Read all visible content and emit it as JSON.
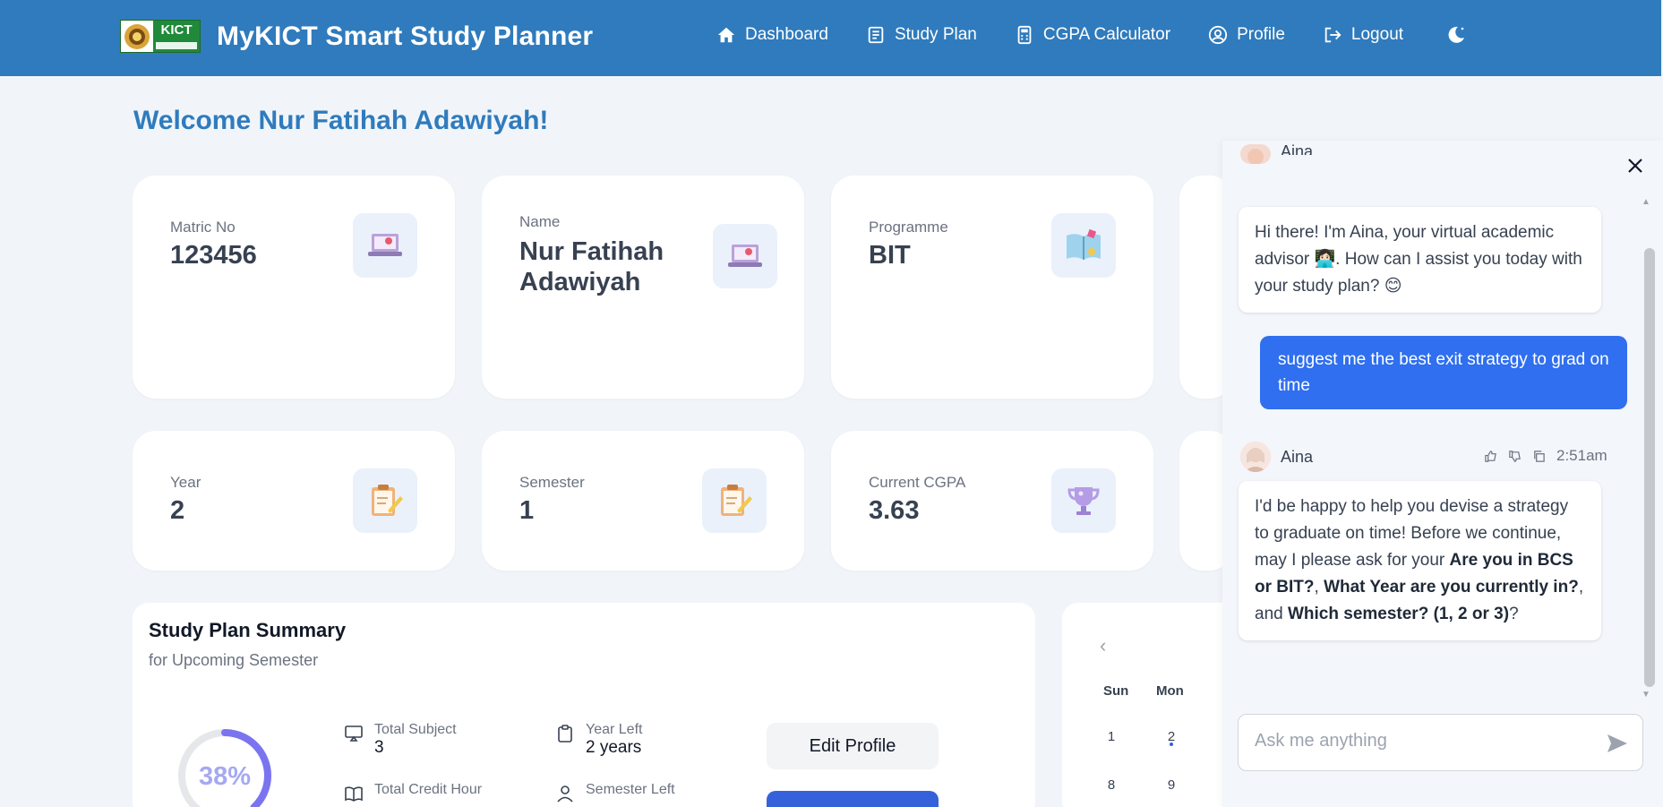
{
  "brand": {
    "logo_text": "KICT",
    "title": "MyKICT Smart Study Planner"
  },
  "nav": {
    "dashboard": "Dashboard",
    "study_plan": "Study Plan",
    "cgpa_calculator": "CGPA Calculator",
    "profile": "Profile",
    "logout": "Logout"
  },
  "welcome": "Welcome Nur Fatihah Adawiyah!",
  "cards": {
    "matric": {
      "label": "Matric No",
      "value": "123456"
    },
    "name": {
      "label": "Name",
      "value": "Nur Fatihah Adawiyah"
    },
    "programme": {
      "label": "Programme",
      "value": "BIT"
    },
    "year": {
      "label": "Year",
      "value": "2"
    },
    "semester": {
      "label": "Semester",
      "value": "1"
    },
    "cgpa": {
      "label": "Current CGPA",
      "value": "3.63"
    }
  },
  "summary": {
    "title": "Study Plan Summary",
    "subtitle": "for Upcoming Semester",
    "progress_text": "38%",
    "progress_value": 0.38,
    "total_subject_label": "Total Subject",
    "total_subject_value": "3",
    "year_left_label": "Year Left",
    "year_left_value": "2 years",
    "total_credit_label": "Total Credit Hour",
    "semester_left_label": "Semester Left",
    "edit_profile": "Edit Profile"
  },
  "calendar": {
    "days_of_week": [
      "Sun",
      "Mon"
    ],
    "week1": [
      "1",
      "2"
    ],
    "week2": [
      "8",
      "9"
    ]
  },
  "chat": {
    "assistant_name": "Aina",
    "messages": [
      {
        "role": "assistant",
        "text": "Hi there! I'm Aina, your virtual academic advisor 👩🏻‍💻. How can I assist you today with your study plan? 😊"
      },
      {
        "role": "user",
        "text": "suggest me the best exit strategy to grad on time"
      },
      {
        "role": "assistant",
        "time": "2:51am",
        "parts": {
          "p1": "I'd be happy to help you devise a strategy to graduate on time! Before we continue, may I please ask for your ",
          "b1": "Are you in BCS or BIT?",
          "p2": ", ",
          "b2": "What Year are you currently in?",
          "p3": ", and ",
          "b3": "Which semester? (1, 2 or 3)",
          "p4": "?"
        }
      }
    ],
    "input_placeholder": "Ask me anything"
  },
  "colors": {
    "navbar": "#2f7bbd",
    "accent": "#2f6ff0",
    "welcome": "#2f7bbd"
  }
}
